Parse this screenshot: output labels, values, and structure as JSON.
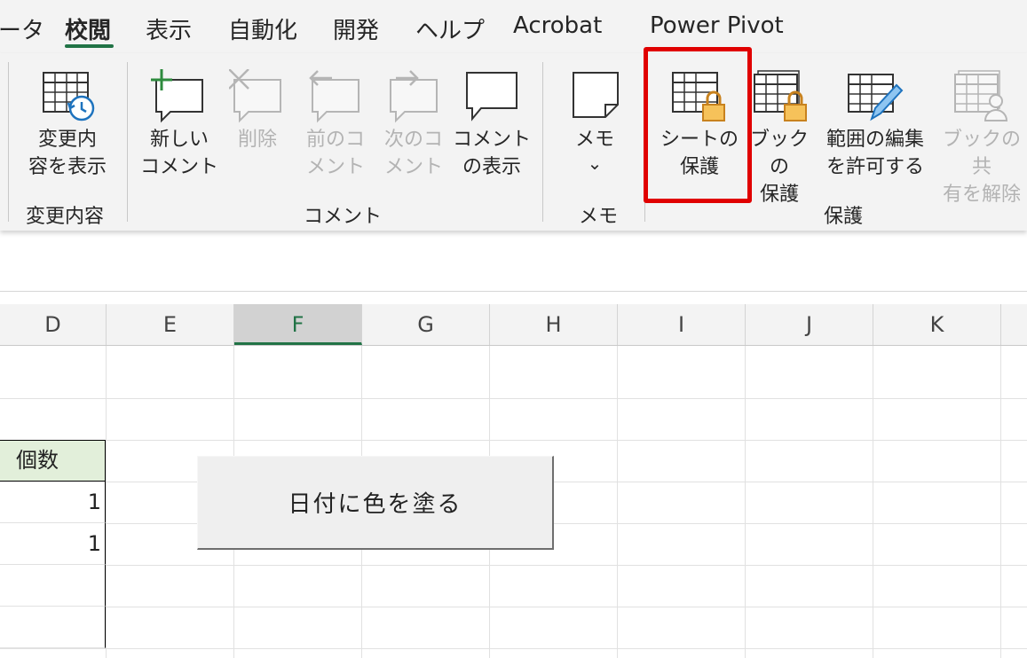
{
  "ribbon_tabs": [
    "ータ",
    "校閲",
    "表示",
    "自動化",
    "開発",
    "ヘルプ",
    "Acrobat",
    "Power Pivot"
  ],
  "active_tab": "校閲",
  "accent_color": "#217346",
  "highlight_color": "#e00000",
  "groups": {
    "changes": {
      "label": "変更内容",
      "buttons": [
        {
          "label": "変更内\n容を表示",
          "icon": "track-changes-icon",
          "enabled": true
        }
      ]
    },
    "comments": {
      "label": "コメント",
      "buttons": [
        {
          "label": "新しい\nコメント",
          "icon": "new-comment-icon",
          "enabled": true
        },
        {
          "label": "削除",
          "icon": "delete-comment-icon",
          "enabled": false
        },
        {
          "label": "前のコ\nメント",
          "icon": "previous-comment-icon",
          "enabled": false
        },
        {
          "label": "次のコ\nメント",
          "icon": "next-comment-icon",
          "enabled": false
        },
        {
          "label": "コメント\nの表示",
          "icon": "show-comments-icon",
          "enabled": true
        }
      ]
    },
    "notes": {
      "label": "メモ",
      "buttons": [
        {
          "label": "メモ",
          "icon": "notes-icon",
          "enabled": true,
          "dropdown_glyph": "⌄"
        }
      ]
    },
    "protect": {
      "label": "保護",
      "buttons": [
        {
          "label": "シートの\n保護",
          "icon": "protect-sheet-icon",
          "enabled": true,
          "highlighted": true
        },
        {
          "label": "ブックの\n保護",
          "icon": "protect-workbook-icon",
          "enabled": true
        },
        {
          "label": "範囲の編集\nを許可する",
          "icon": "allow-edit-ranges-icon",
          "enabled": true
        },
        {
          "label": "ブックの共\n有を解除",
          "icon": "unshare-workbook-icon",
          "enabled": false
        }
      ]
    }
  },
  "columns": [
    "D",
    "E",
    "F",
    "G",
    "H",
    "I",
    "J",
    "K"
  ],
  "selected_column": "F",
  "table": {
    "header": "個数",
    "header_fill": "#e2efda",
    "values": [
      "1",
      "1"
    ]
  },
  "form_button_label": "日付に色を塗る"
}
